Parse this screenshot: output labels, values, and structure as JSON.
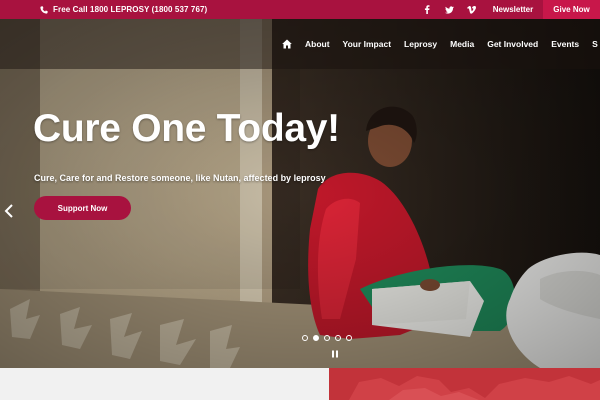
{
  "topbar": {
    "call_text": "Free Call 1800 LEPROSY (1800 537 767)",
    "social_icons": [
      "facebook-icon",
      "twitter-icon",
      "vimeo-icon"
    ],
    "newsletter_label": "Newsletter",
    "give_label": "Give Now",
    "color": "#a8123f"
  },
  "nav": {
    "items": [
      "About",
      "Your Impact",
      "Leprosy",
      "Media",
      "Get Involved",
      "Events",
      "S"
    ]
  },
  "hero": {
    "headline": "Cure One Today!",
    "subheadline": "Cure, Care for and Restore someone, like Nutan, affected by leprosy",
    "button_label": "Support Now",
    "slide_count": 5,
    "active_slide": 2
  },
  "colors": {
    "brand": "#a8123f",
    "accent_dark": "#c8174a",
    "footer_red": "#c2333a"
  }
}
